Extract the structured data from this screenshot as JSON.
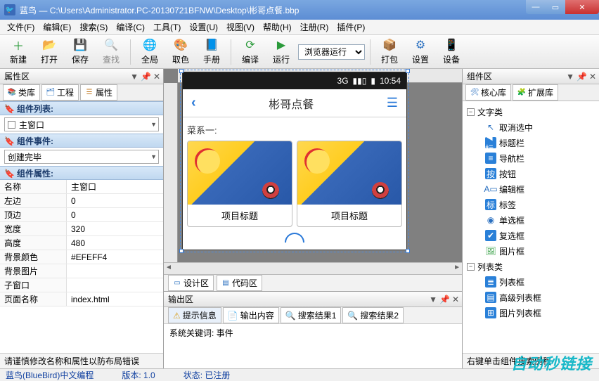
{
  "window": {
    "app_name": "蓝鸟",
    "title_path": "C:\\Users\\Administrator.PC-20130721BFNW\\Desktop\\彬哥点餐.bbp"
  },
  "menu": [
    "文件(F)",
    "编辑(E)",
    "搜索(S)",
    "编译(C)",
    "工具(T)",
    "设置(U)",
    "视图(V)",
    "帮助(H)",
    "注册(R)",
    "插件(P)"
  ],
  "toolbar": {
    "new": "新建",
    "open": "打开",
    "save": "保存",
    "find": "查找",
    "global": "全局",
    "pick": "取色",
    "manual": "手册",
    "compile": "编译",
    "run": "运行",
    "run_select": "浏览器运行",
    "pack": "打包",
    "settings": "设置",
    "device": "设备"
  },
  "left": {
    "panel_title": "属性区",
    "tabs": {
      "libs": "类库",
      "project": "工程",
      "props": "属性"
    },
    "h_components": "组件列表:",
    "combo_main": "主窗口",
    "h_events": "组件事件:",
    "combo_event": "创建完毕",
    "h_props": "组件属性:",
    "props": [
      {
        "k": "名称",
        "v": "主窗口"
      },
      {
        "k": "左边",
        "v": "0"
      },
      {
        "k": "顶边",
        "v": "0"
      },
      {
        "k": "宽度",
        "v": "320"
      },
      {
        "k": "高度",
        "v": "480"
      },
      {
        "k": "背景颜色",
        "v": "#EFEFF4"
      },
      {
        "k": "背景图片",
        "v": ""
      },
      {
        "k": "子窗口",
        "v": ""
      },
      {
        "k": "页面名称",
        "v": "index.html"
      }
    ],
    "footer": "请谨慎修改名称和属性以防布局错误"
  },
  "phone": {
    "status_3g": "3G",
    "status_time": "10:54",
    "nav_title": "彬哥点餐",
    "section": "菜系一:",
    "card_title": "项目标题"
  },
  "center_tabs": {
    "design": "设计区",
    "code": "代码区"
  },
  "output": {
    "panel_title": "输出区",
    "tabs": {
      "hint": "提示信息",
      "content": "输出内容",
      "r1": "搜索结果1",
      "r2": "搜索结果2"
    },
    "body": "系统关键词: 事件"
  },
  "right": {
    "panel_title": "组件区",
    "tabs": {
      "core": "核心库",
      "ext": "扩展库"
    },
    "tree": {
      "text_cat": "文字类",
      "items_text": [
        "取消选中",
        "标题栏",
        "导航栏",
        "按钮",
        "编辑框",
        "标签",
        "单选框",
        "复选框",
        "图片框"
      ],
      "list_cat": "列表类",
      "items_list": [
        "列表框",
        "高级列表框",
        "图片列表框"
      ]
    },
    "footer": "右键单击组件搜索例程"
  },
  "status": {
    "left": "蓝鸟(BlueBird)中文编程",
    "version_label": "版本:",
    "version": "1.0",
    "state_label": "状态:",
    "state": "已注册"
  },
  "watermark": "自动秒链接"
}
